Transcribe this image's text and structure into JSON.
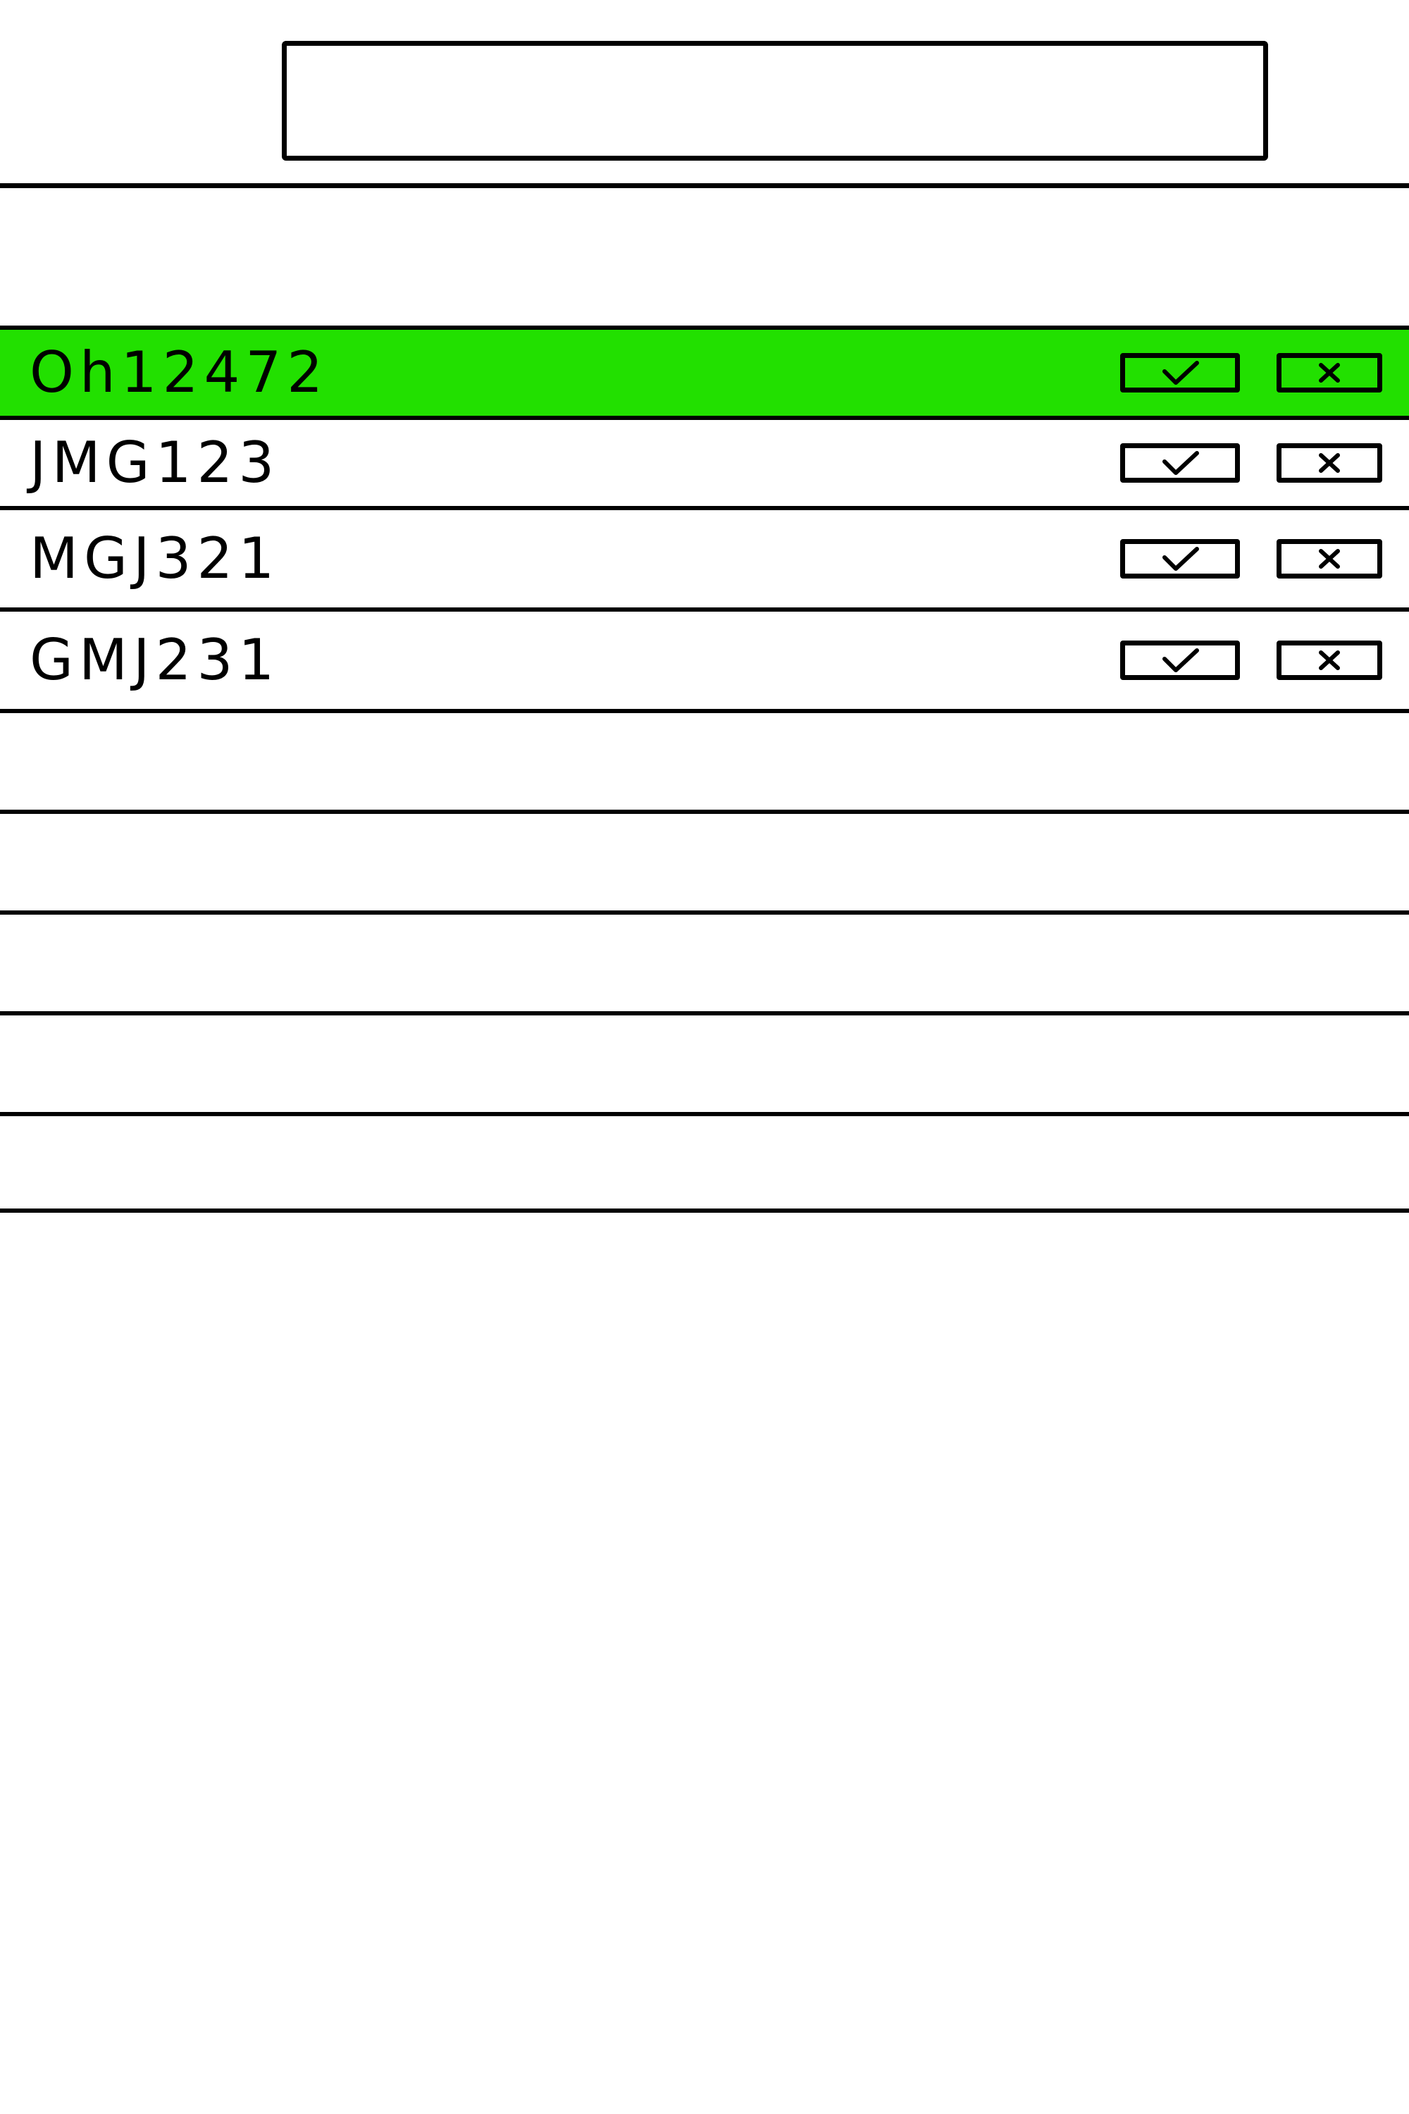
{
  "header": {
    "search_value": ""
  },
  "list": {
    "items": [
      {
        "label": "Oh12472",
        "selected": true
      },
      {
        "label": "JMG123",
        "selected": false
      },
      {
        "label": "MGJ321",
        "selected": false
      },
      {
        "label": "GMJ231",
        "selected": false
      }
    ],
    "empty_rows": 5
  },
  "icons": {
    "accept": "check-icon",
    "reject": "x-icon"
  },
  "colors": {
    "selected_row": "#22e000",
    "line": "#000000",
    "background": "#ffffff"
  }
}
